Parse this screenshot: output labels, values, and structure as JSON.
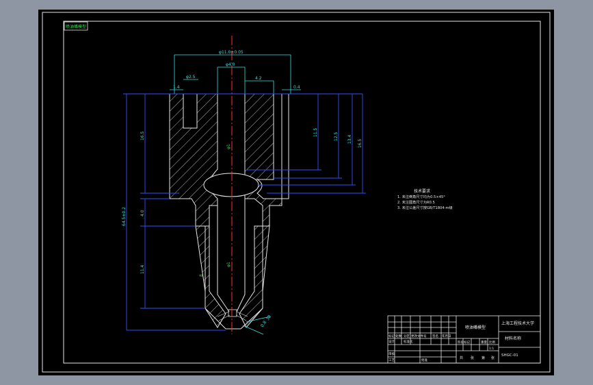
{
  "drawing": {
    "corner_label": "喷油嘴模型",
    "dimensions": {
      "top_width": "φ11.0±0.05",
      "inner_dia": "φ4.0",
      "hole_dia": "φ2.5",
      "step_right": "4.2",
      "wall_left": "1.4",
      "wall_right": "0.4",
      "left_top_height": "16.5",
      "right_h1": "11.5",
      "right_h2": "12.5",
      "right_h3": "13.4",
      "right_h4": "16.5",
      "center_top": "φ1",
      "center_lower": "φ1",
      "left_total": "64.5±0.2",
      "left_mid": "4.0",
      "left_lower": "11.4",
      "tip_dim": "0.8",
      "tip_dim_label": "30",
      "lower_small": "8"
    },
    "tech_notes": {
      "title": "技术要求",
      "items": [
        "1. 未注倒角尺寸均为0.5×45°",
        "2. 未注圆角尺寸为R0.5",
        "3. 未注公差尺寸按GB/T1804-m级"
      ]
    },
    "title_block": {
      "part_name": "喷油嘴模型",
      "company": "上海工程技术大学",
      "material": "材料名称",
      "drawing_no": "SHGC-01",
      "grid_labels": [
        "标记",
        "处数",
        "分区",
        "更改文件号",
        "签名",
        "年月日"
      ],
      "grid_labels2": [
        "设计",
        "标准化",
        "审核",
        "工艺",
        "批准"
      ],
      "stage_labels": [
        "阶段标记",
        "重量",
        "比例"
      ],
      "sheet_labels": [
        "共",
        "张",
        "第",
        "张"
      ],
      "scale": "1:1"
    }
  }
}
